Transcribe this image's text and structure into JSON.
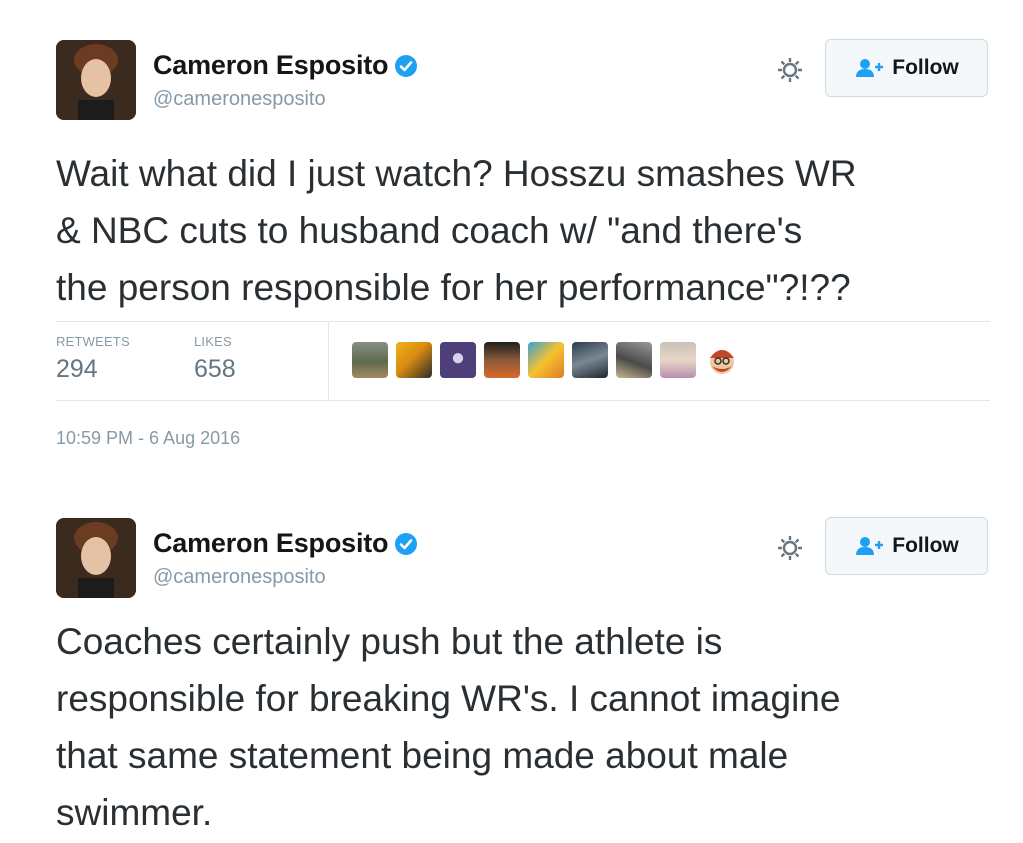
{
  "tweets": [
    {
      "author_name": "Cameron Esposito",
      "author_handle": "@cameronesposito",
      "follow_label": "Follow",
      "text_lines": [
        "Wait what did I just watch? Hosszu smashes WR",
        "& NBC cuts to husband coach w/ \"and there's",
        "the person responsible for her performance\"?!??"
      ],
      "retweets_label": "RETWEETS",
      "retweets_count": "294",
      "likes_label": "LIKES",
      "likes_count": "658",
      "timestamp": "10:59 PM - 6 Aug 2016"
    },
    {
      "author_name": "Cameron Esposito",
      "author_handle": "@cameronesposito",
      "follow_label": "Follow",
      "text_lines": [
        "Coaches certainly push but the athlete is",
        "responsible for breaking WR's. I cannot imagine",
        "that same statement being made about male",
        "swimmer."
      ]
    }
  ],
  "colors": {
    "verified": "#1da1f2",
    "follow_icon": "#1da1f2",
    "muted_text": "#8899a6",
    "body_text": "#292f33"
  },
  "icons": {
    "verified": "verified-badge-icon",
    "gear": "gear-icon",
    "follow": "add-person-icon"
  }
}
